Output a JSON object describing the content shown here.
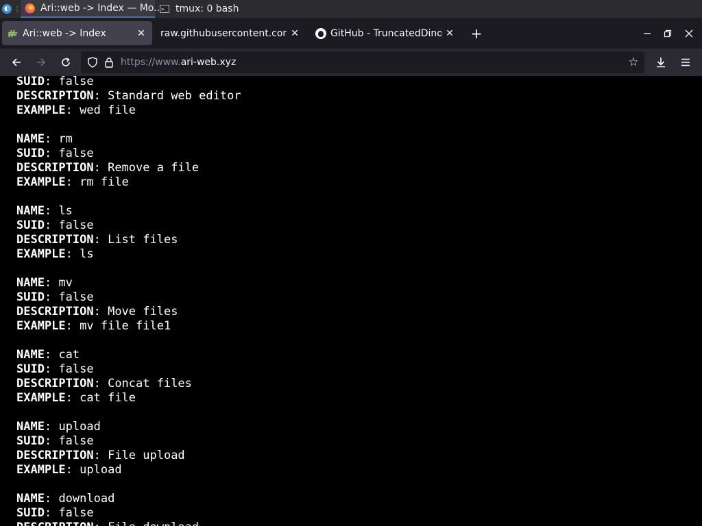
{
  "taskbar": {
    "launcher_icon": "distro-icon",
    "tasks": [
      {
        "title": "Ari::web -> Index — Mo...",
        "icon": "firefox-icon",
        "active": true
      },
      {
        "title": "tmux: 0 bash",
        "icon": "terminal-icon",
        "active": false
      }
    ]
  },
  "tabs": [
    {
      "label": "Ari::web -> Index",
      "icon": "site-favicon",
      "selected": true
    },
    {
      "label": "raw.githubusercontent.com/",
      "icon": "none",
      "selected": false
    },
    {
      "label": "GitHub - TruncatedDinosour",
      "icon": "github-icon",
      "selected": false
    }
  ],
  "url": {
    "prefix": "https://www.",
    "host": "ari-web.xyz"
  },
  "listing": {
    "entries": [
      {
        "fields": [
          {
            "key": "SUID",
            "value": "false"
          },
          {
            "key": "DESCRIPTION",
            "value": "Standard web editor"
          },
          {
            "key": "EXAMPLE",
            "value": "wed file"
          }
        ]
      },
      {
        "fields": [
          {
            "key": "NAME",
            "value": "rm"
          },
          {
            "key": "SUID",
            "value": "false"
          },
          {
            "key": "DESCRIPTION",
            "value": "Remove a file"
          },
          {
            "key": "EXAMPLE",
            "value": "rm file"
          }
        ]
      },
      {
        "fields": [
          {
            "key": "NAME",
            "value": "ls"
          },
          {
            "key": "SUID",
            "value": "false"
          },
          {
            "key": "DESCRIPTION",
            "value": "List files"
          },
          {
            "key": "EXAMPLE",
            "value": "ls"
          }
        ]
      },
      {
        "fields": [
          {
            "key": "NAME",
            "value": "mv"
          },
          {
            "key": "SUID",
            "value": "false"
          },
          {
            "key": "DESCRIPTION",
            "value": "Move files"
          },
          {
            "key": "EXAMPLE",
            "value": "mv file file1"
          }
        ]
      },
      {
        "fields": [
          {
            "key": "NAME",
            "value": "cat"
          },
          {
            "key": "SUID",
            "value": "false"
          },
          {
            "key": "DESCRIPTION",
            "value": "Concat files"
          },
          {
            "key": "EXAMPLE",
            "value": "cat file"
          }
        ]
      },
      {
        "fields": [
          {
            "key": "NAME",
            "value": "upload"
          },
          {
            "key": "SUID",
            "value": "false"
          },
          {
            "key": "DESCRIPTION",
            "value": "File upload"
          },
          {
            "key": "EXAMPLE",
            "value": "upload"
          }
        ]
      },
      {
        "fields": [
          {
            "key": "NAME",
            "value": "download"
          },
          {
            "key": "SUID",
            "value": "false"
          },
          {
            "key": "DESCRIPTION",
            "value": "File download"
          }
        ]
      }
    ]
  },
  "colors": {
    "page_background": "#000000",
    "text": "#ffffff",
    "tabbar": "#1c1b22",
    "navbar": "#2b2a33"
  }
}
